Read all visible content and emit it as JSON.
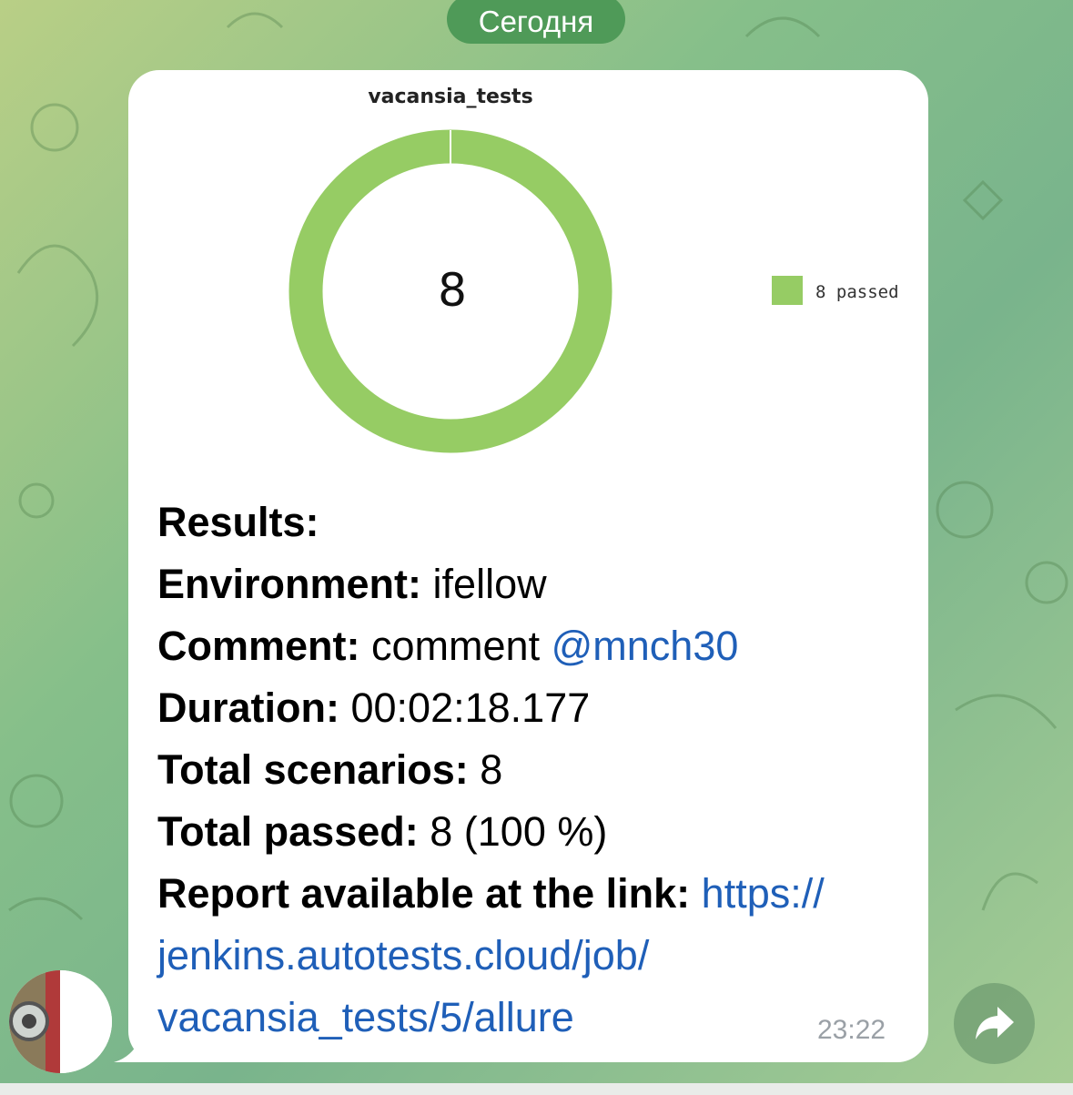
{
  "date_separator": "Сегодня",
  "message": {
    "chart": {
      "title": "vacansia_tests",
      "center_value": "8",
      "legend_label": "8 passed",
      "color_passed": "#96cc64"
    },
    "chart_data": {
      "type": "pie",
      "title": "vacansia_tests",
      "categories": [
        "8 passed"
      ],
      "values": [
        8
      ]
    },
    "results_label": "Results:",
    "environment_label": "Environment:",
    "environment_value": "ifellow",
    "comment_label": "Comment:",
    "comment_value": "comment",
    "comment_mention": "@mnch30",
    "duration_label": "Duration:",
    "duration_value": "00:02:18.177",
    "total_scenarios_label": "Total scenarios:",
    "total_scenarios_value": "8",
    "total_passed_label": "Total passed:",
    "total_passed_value": "8 (100 %)",
    "report_label": "Report available at the link:",
    "report_link_line1": "https://",
    "report_link_line2": "jenkins.autotests.cloud/job/",
    "report_link_line3": "vacansia_tests/5/allure",
    "time": "23:22"
  },
  "icons": {
    "share": "share-arrow-icon",
    "avatar": "sender-avatar"
  }
}
